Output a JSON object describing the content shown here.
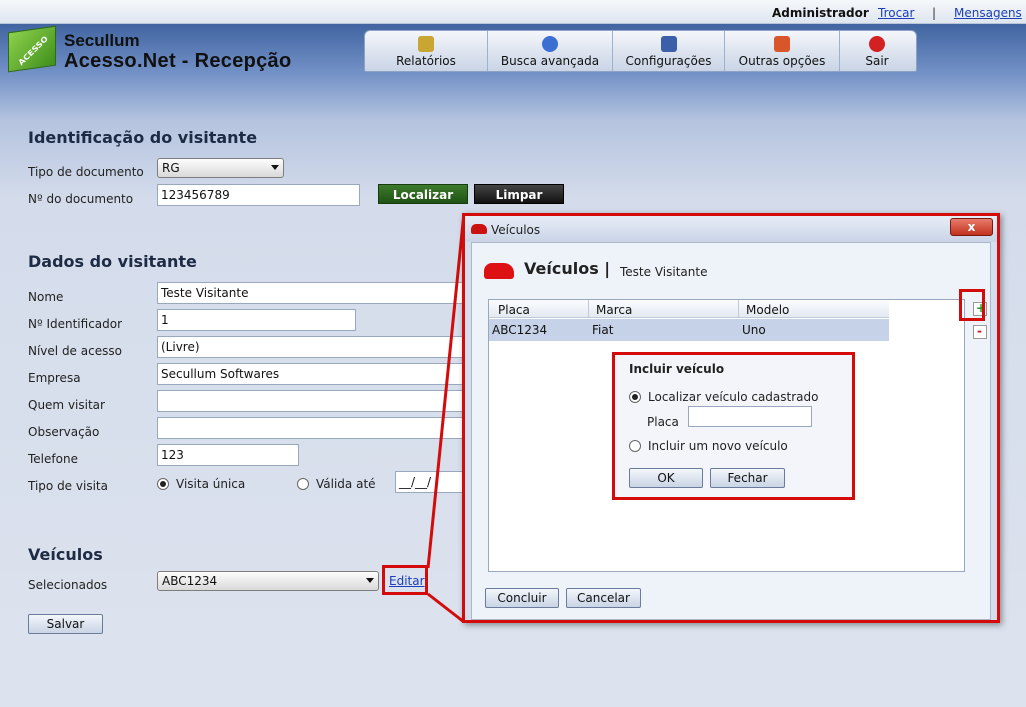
{
  "topbar": {
    "user": "Administrador",
    "switch_link": "Trocar",
    "separator": "|",
    "messages_link": "Mensagens"
  },
  "brand": {
    "line1": "Secullum",
    "line2": "Acesso.Net - Recepção",
    "logo_text": "ACESSO"
  },
  "toolbar": {
    "items": [
      {
        "label": "Relatórios",
        "icon": "reports-icon",
        "color": "#c9a531"
      },
      {
        "label": "Busca avançada",
        "icon": "search-icon",
        "color": "#3b6fd1"
      },
      {
        "label": "Configurações",
        "icon": "settings-icon",
        "color": "#3b5fa8"
      },
      {
        "label": "Outras opções",
        "icon": "options-icon",
        "color": "#d9552a"
      },
      {
        "label": "Sair",
        "icon": "power-icon",
        "color": "#d32020"
      }
    ]
  },
  "identificacao": {
    "title": "Identificação do visitante",
    "doc_type_label": "Tipo de documento",
    "doc_type_value": "RG",
    "doc_number_label": "Nº do documento",
    "doc_number_value": "123456789",
    "locate_button": "Localizar",
    "clear_button": "Limpar"
  },
  "dados": {
    "title": "Dados do visitante",
    "nome_label": "Nome",
    "nome_value": "Teste Visitante",
    "ident_label": "Nº Identificador",
    "ident_value": "1",
    "nivel_label": "Nível de acesso",
    "nivel_value": "(Livre)",
    "empresa_label": "Empresa",
    "empresa_value": "Secullum Softwares",
    "quem_label": "Quem visitar",
    "quem_value": "",
    "obs_label": "Observação",
    "obs_value": "",
    "tel_label": "Telefone",
    "tel_value": "123",
    "tipo_label": "Tipo de visita",
    "unica_label": "Visita única",
    "valida_label": "Válida até",
    "date_value": "__/__/"
  },
  "veiculos": {
    "title": "Veículos",
    "selected_label": "Selecionados",
    "selected_value": "ABC1234",
    "edit_link": "Editar",
    "save_button": "Salvar"
  },
  "dialog": {
    "window_title": "Veículos",
    "heading": "Veículos |",
    "visitor": "Teste Visitante",
    "columns": [
      "Placa",
      "Marca",
      "Modelo"
    ],
    "rows": [
      {
        "placa": "ABC1234",
        "marca": "Fiat",
        "modelo": "Uno"
      }
    ],
    "conclude_button": "Concluir",
    "cancel_button": "Cancelar",
    "close": "x"
  },
  "popup": {
    "title": "Incluir veículo",
    "option_locate": "Localizar veículo cadastrado",
    "plate_label": "Placa",
    "plate_value": "",
    "option_new": "Incluir um novo veículo",
    "ok_button": "OK",
    "close_button": "Fechar"
  }
}
